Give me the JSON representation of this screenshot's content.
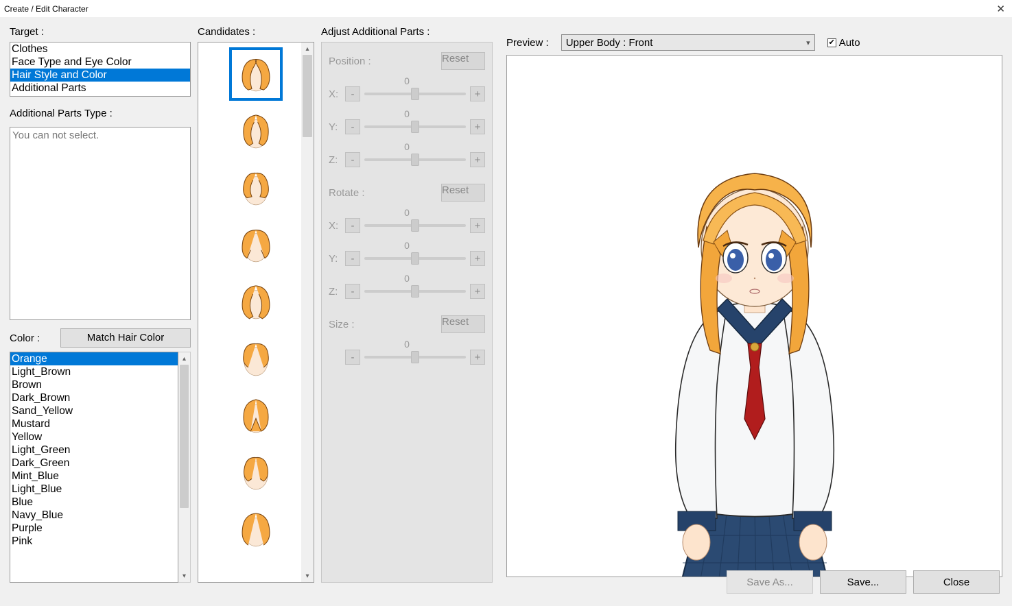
{
  "window": {
    "title": "Create / Edit Character"
  },
  "labels": {
    "target": "Target :",
    "candidates": "Candidates :",
    "adjust": "Adjust Additional Parts :",
    "additional_parts_type": "Additional Parts Type :",
    "color": "Color :",
    "preview": "Preview :",
    "auto": "Auto"
  },
  "target_items": [
    "Clothes",
    "Face Type and Eye Color",
    "Hair Style and Color",
    "Additional Parts"
  ],
  "target_selected": 2,
  "additional_parts_placeholder": "You can not select.",
  "match_hair_button": "Match Hair Color",
  "colors": [
    "Orange",
    "Light_Brown",
    "Brown",
    "Dark_Brown",
    "Sand_Yellow",
    "Mustard",
    "Yellow",
    "Light_Green",
    "Dark_Green",
    "Mint_Blue",
    "Light_Blue",
    "Blue",
    "Navy_Blue",
    "Purple",
    "Pink"
  ],
  "color_selected": 0,
  "adjust": {
    "position": {
      "label": "Position :",
      "reset": "Reset",
      "x": {
        "label": "X:",
        "value": "0"
      },
      "y": {
        "label": "Y:",
        "value": "0"
      },
      "z": {
        "label": "Z:",
        "value": "0"
      }
    },
    "rotate": {
      "label": "Rotate :",
      "reset": "Reset",
      "x": {
        "label": "X:",
        "value": "0"
      },
      "y": {
        "label": "Y:",
        "value": "0"
      },
      "z": {
        "label": "Z:",
        "value": "0"
      }
    },
    "size": {
      "label": "Size :",
      "reset": "Reset",
      "value": "0"
    },
    "minus": "-",
    "plus": "+"
  },
  "preview_option": "Upper Body : Front",
  "footer": {
    "save_as": "Save As...",
    "save": "Save...",
    "close": "Close"
  },
  "candidate_count": 9
}
